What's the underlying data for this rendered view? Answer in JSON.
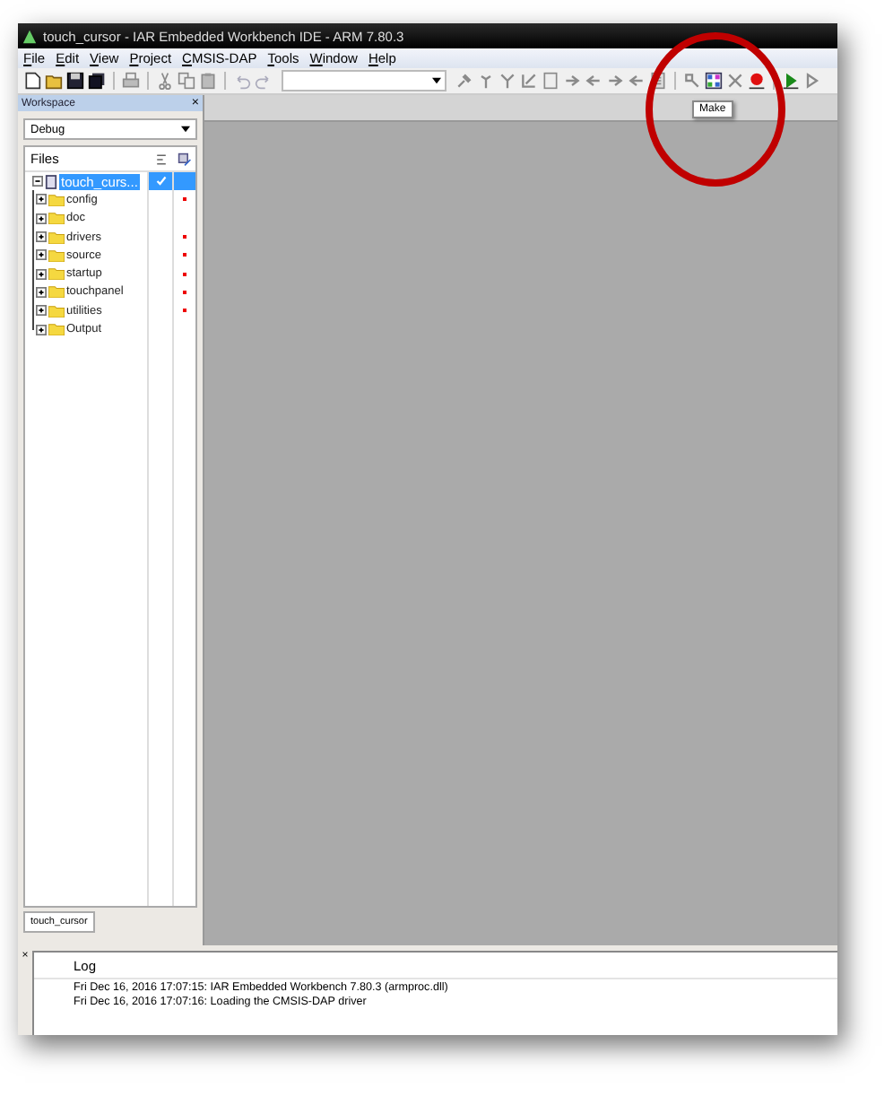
{
  "window": {
    "title": "touch_cursor - IAR Embedded Workbench IDE - ARM 7.80.3"
  },
  "menu": [
    "File",
    "Edit",
    "View",
    "Project",
    "CMSIS-DAP",
    "Tools",
    "Window",
    "Help"
  ],
  "tooltip": "Make",
  "workspace": {
    "title": "Workspace",
    "close": "×",
    "configuration": "Debug",
    "files_header": "Files",
    "project": {
      "name": "touch_curs...",
      "selected": true,
      "checked": true,
      "expanded": true,
      "children": [
        {
          "name": "config",
          "expanded": false,
          "modified": true
        },
        {
          "name": "doc",
          "expanded": false,
          "modified": false
        },
        {
          "name": "drivers",
          "expanded": false,
          "modified": true
        },
        {
          "name": "source",
          "expanded": false,
          "modified": true
        },
        {
          "name": "startup",
          "expanded": false,
          "modified": true
        },
        {
          "name": "touchpanel",
          "expanded": false,
          "modified": true
        },
        {
          "name": "utilities",
          "expanded": false,
          "modified": true
        },
        {
          "name": "Output",
          "expanded": false,
          "modified": false
        }
      ]
    },
    "tabs": [
      {
        "label": "touch_cursor",
        "selected": true
      }
    ]
  },
  "log": {
    "close": "×",
    "title": "Log",
    "lines": [
      "Fri Dec 16, 2016 17:07:15: IAR Embedded Workbench 7.80.3 (armproc.dll)",
      "Fri Dec 16, 2016 17:07:16: Loading the CMSIS-DAP driver"
    ]
  }
}
